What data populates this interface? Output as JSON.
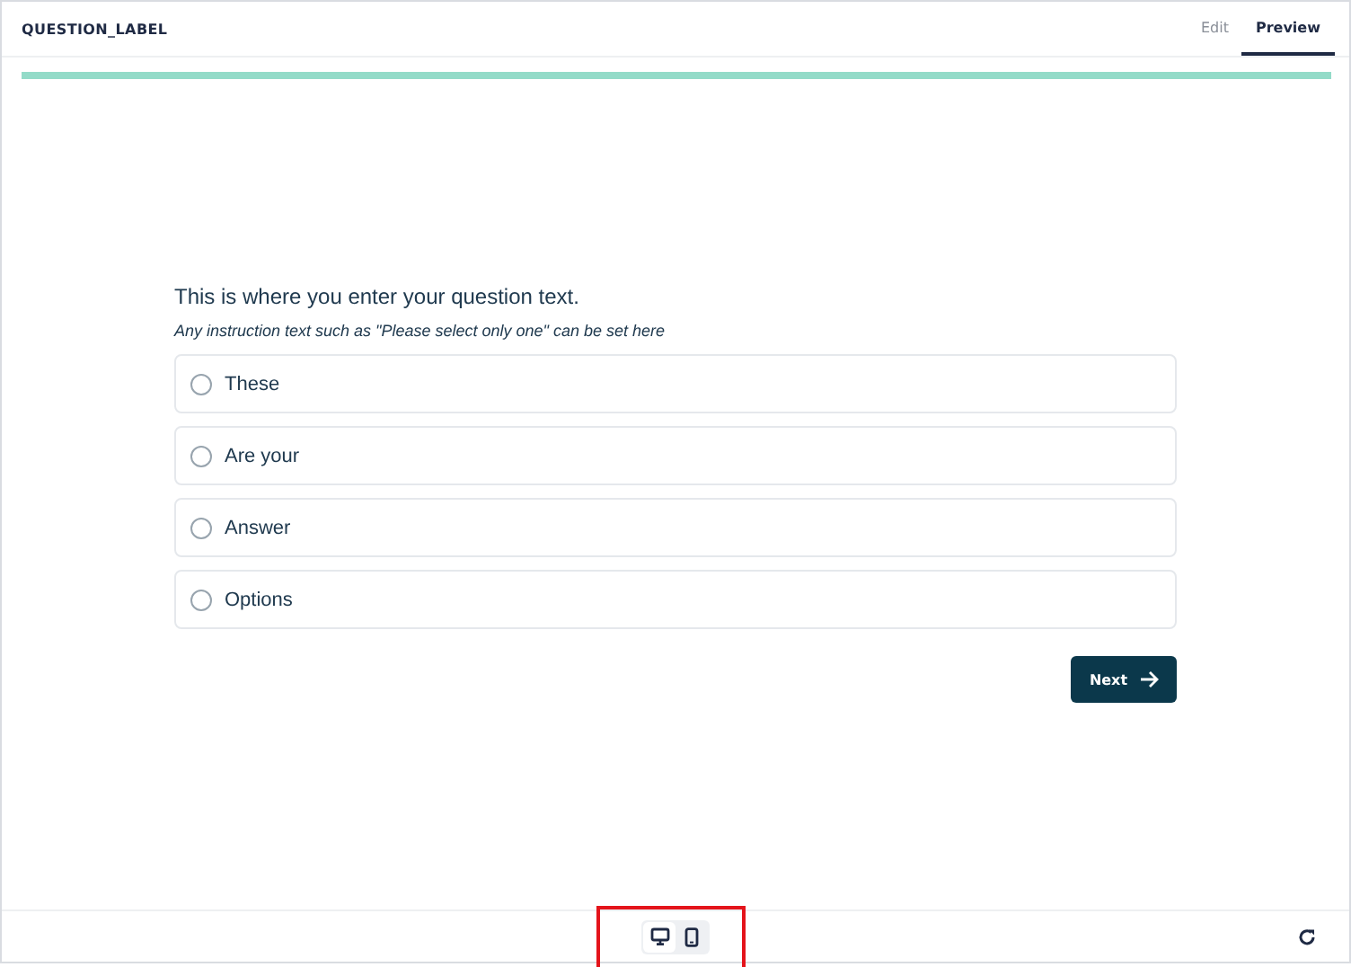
{
  "header": {
    "title": "QUESTION_LABEL",
    "tabs": [
      {
        "label": "Edit",
        "selected": false
      },
      {
        "label": "Preview",
        "selected": true
      }
    ]
  },
  "progress": {
    "level": 1
  },
  "question": {
    "text": "This is where you enter your question text.",
    "instruction": "Any instruction text such as \"Please select only one\" can be set here",
    "options": [
      {
        "label": "These",
        "selected": false
      },
      {
        "label": "Are your",
        "selected": false
      },
      {
        "label": "Answer",
        "selected": false
      },
      {
        "label": "Options",
        "selected": false
      }
    ]
  },
  "next_button": {
    "label": "Next"
  },
  "footer": {
    "devices": [
      {
        "kind": "desktop",
        "selected": true
      },
      {
        "kind": "mobile",
        "selected": false
      }
    ],
    "highlighted": true
  }
}
